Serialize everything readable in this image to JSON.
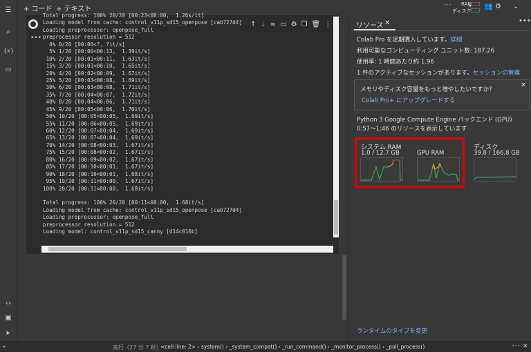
{
  "toolbar": {
    "add_code": "+ コード",
    "add_text": "+ テキスト",
    "ram_label": "RAM",
    "disk_label": "ディスク"
  },
  "cell": {
    "output_lines": [
      "Total progress: 100% 20/20 [00:23<00:00,  1.26s/it]",
      "Loading model from cache: control_v11p_sd15_openpose [cab727d4]",
      "Loading preprocessor: openpose_full",
      "preprocessor resolution = 512",
      "  0% 0/20 [00:00<?, ?it/s]",
      "  5% 1/20 [00:00<00:13,  1.39it/s]",
      " 10% 2/20 [00:01<00:11,  1.63it/s]",
      " 15% 3/20 [00:01<00:10,  1.65it/s]",
      " 20% 4/20 [00:02<00:09,  1.67it/s]",
      " 25% 5/20 [00:03<00:08,  1.69it/s]",
      " 30% 6/20 [00:03<00:08,  1.71it/s]",
      " 35% 7/20 [00:04<00:07,  1.72it/s]",
      " 40% 8/20 [00:04<00:06,  1.71it/s]",
      " 45% 9/20 [00:05<00:06,  1.70it/s]",
      " 50% 10/20 [00:05<00:05,  1.69it/s]",
      " 55% 11/20 [00:06<00:05,  1.69it/s]",
      " 60% 12/20 [00:07<00:04,  1.69it/s]",
      " 65% 13/20 [00:07<00:04,  1.69it/s]",
      " 70% 14/20 [00:08<00:03,  1.67it/s]",
      " 75% 15/20 [00:08<00:02,  1.67it/s]",
      " 80% 16/20 [00:09<00:02,  1.67it/s]",
      " 85% 17/20 [00:10<00:01,  1.67it/s]",
      " 90% 18/20 [00:10<00:01,  1.68it/s]",
      " 95% 19/20 [00:11<00:00,  1.67it/s]",
      "100% 20/20 [00:11<00:00,  1.68it/s]",
      "",
      "Total progress: 100% 20/20 [00:11<00:00,  1.68it/s]",
      "Loading model from cache: control_v11p_sd15_openpose [cab727d4]",
      "Loading preprocessor: openpose_full",
      "preprocessor resolution = 512",
      "Loading model: control_v11p_sd15_canny [d14c016b]"
    ]
  },
  "panel": {
    "tab": "リソース",
    "subscription": "Colab Pro を定期購入しています。",
    "details_link": "詳細",
    "units": "利用可能なコンピューティング ユニット数: 187.26",
    "usage": "使用率: 1 時間あたり約 1.96",
    "sessions": "1 件のアクティブなセッションがあります。",
    "manage_link": "セッションの管理",
    "promo_title": "メモリやディスク容量をもっと増やしたいですか？",
    "promo_link": "Colab Pro+ にアップグレードする",
    "backend": "Python 3 Google Compute Engine バックエンド (GPU)",
    "range": "0:57〜1:46 のリソースを表示しています",
    "ram_title": "システム RAM",
    "ram_value": "1.0 / 12.7 GB",
    "gpu_title": "GPU RAM",
    "disk_title": "ディスク",
    "disk_value": "39.8 / 166.8 GB",
    "change_runtime": "ランタイムのタイプを変更"
  },
  "status": {
    "exec": "実行（27 分 7 秒）",
    "trace": "<cell line: 2> › system() › _system_compat() › _run_command() › _monitor_process() › _poll_process()"
  },
  "colors": {
    "highlight": "#e00000",
    "green": "#34a853",
    "orange": "#e8a020",
    "red": "#c83030",
    "link": "#8ab4f8"
  }
}
